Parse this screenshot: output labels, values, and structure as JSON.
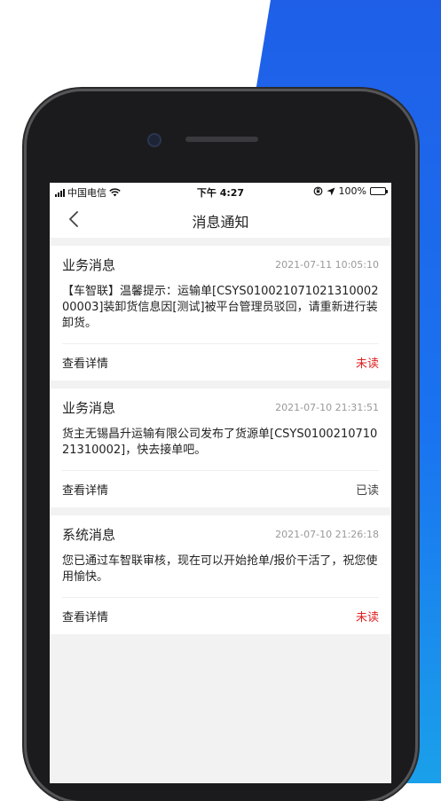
{
  "status_bar": {
    "carrier": "中国电信",
    "time": "下午 4:27",
    "battery": "100%"
  },
  "header": {
    "title": "消息通知",
    "back_icon": "chevron-left-icon"
  },
  "messages": [
    {
      "category": "业务消息",
      "time": "2021-07-11 10:05:10",
      "content": "【车智联】温馨提示：运输单[CSYS01002107102131000200003]装卸货信息因[测试]被平台管理员驳回，请重新进行装卸货。",
      "action": "查看详情",
      "status": "未读"
    },
    {
      "category": "业务消息",
      "time": "2021-07-10 21:31:51",
      "content": "货主无锡昌升运输有限公司发布了货源单[CSYS010021071021310002]，快去接单吧。",
      "action": "查看详情",
      "status": "已读"
    },
    {
      "category": "系统消息",
      "time": "2021-07-10 21:26:18",
      "content": "您已通过车智联审核，现在可以开始抢单/报价干活了，祝您使用愉快。",
      "action": "查看详情",
      "status": "未读"
    }
  ],
  "colors": {
    "unread": "#e02020",
    "read": "#444444",
    "brand_blue": "#1f5fe8"
  }
}
